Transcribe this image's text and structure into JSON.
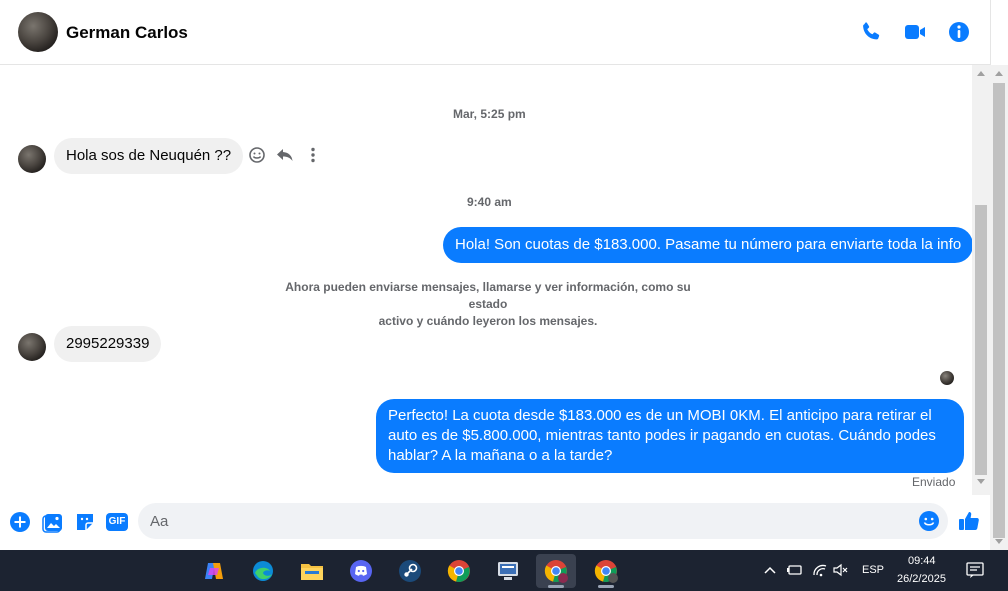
{
  "header": {
    "contact_name": "German Carlos",
    "icons": [
      "phone-icon",
      "video-camera-icon",
      "info-icon"
    ]
  },
  "chat": {
    "timestamp_1": "Mar, 5:25 pm",
    "msg_in_1": "Hola sos de Neuquén ??",
    "timestamp_2": "9:40 am",
    "msg_out_1": "Hola! Son cuotas de $183.000. Pasame tu número para enviarte toda la info",
    "system_note_line1": "Ahora pueden enviarse mensajes, llamarse y ver información, como su estado",
    "system_note_line2": "activo y cuándo leyeron los mensajes.",
    "msg_in_2": "2995229339",
    "msg_out_2_line1": "Perfecto! La cuota desde $183.000 es de un MOBI 0KM. El anticipo para retirar el",
    "msg_out_2_line2": "auto es de $5.800.000, mientras tanto podes ir pagando en cuotas. Cuándo podes",
    "msg_out_2_line3": "hablar? A la mañana o a la tarde?",
    "sent_status": "Enviado"
  },
  "composer": {
    "placeholder": "Aa",
    "gif_label": "GIF"
  },
  "taskbar": {
    "language": "ESP",
    "time": "09:44",
    "date": "26/2/2025"
  },
  "colors": {
    "accent": "#0a7cff",
    "bubble_in": "#f0f0f0",
    "taskbar_bg": "#1c2331"
  }
}
